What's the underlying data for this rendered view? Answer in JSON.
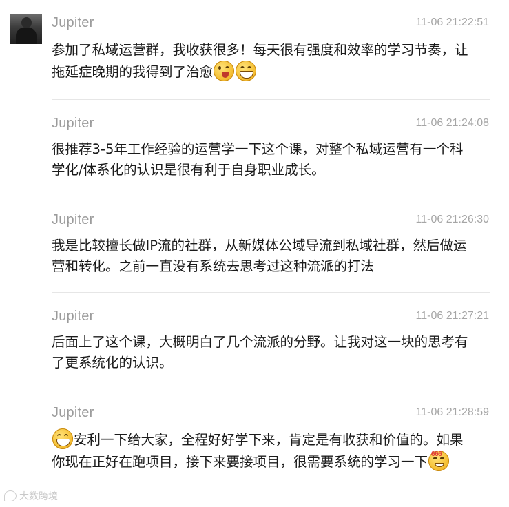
{
  "messages": [
    {
      "sender": "Jupiter",
      "time": "11-06 21:22:51",
      "text": "参加了私域运营群，我收获很多！每天很有强度和效率的学习节奏，让拖延症晚期的我得到了治愈",
      "trailing_emojis": [
        "winking-tongue-emoji",
        "grinning-emoji"
      ]
    },
    {
      "sender": "Jupiter",
      "time": "11-06 21:24:08",
      "text": "很推荐3-5年工作经验的运营学一下这个课，对整个私域运营有一个科学化/体系化的认识是很有利于自身职业成长。"
    },
    {
      "sender": "Jupiter",
      "time": "11-06 21:26:30",
      "text": "我是比较擅长做IP流的社群，从新媒体公域导流到私域社群，然后做运营和转化。之前一直没有系统去思考过这种流派的打法"
    },
    {
      "sender": "Jupiter",
      "time": "11-06 21:27:21",
      "text": "后面上了这个课，大概明白了几个流派的分野。让我对这一块的思考有了更系统化的认识。"
    },
    {
      "sender": "Jupiter",
      "time": "11-06 21:28:59",
      "text": "安利一下给大家，全程好好学下来，肯定是有收获和价值的。如果你现在正好在跑项目，接下来要接项目，很需要系统的学习一下",
      "leading_emojis": [
        "grinning-emoji"
      ],
      "trailing_emojis": [
        "666-emoji"
      ],
      "badge_666": "666"
    }
  ],
  "watermark": "大数跨境"
}
